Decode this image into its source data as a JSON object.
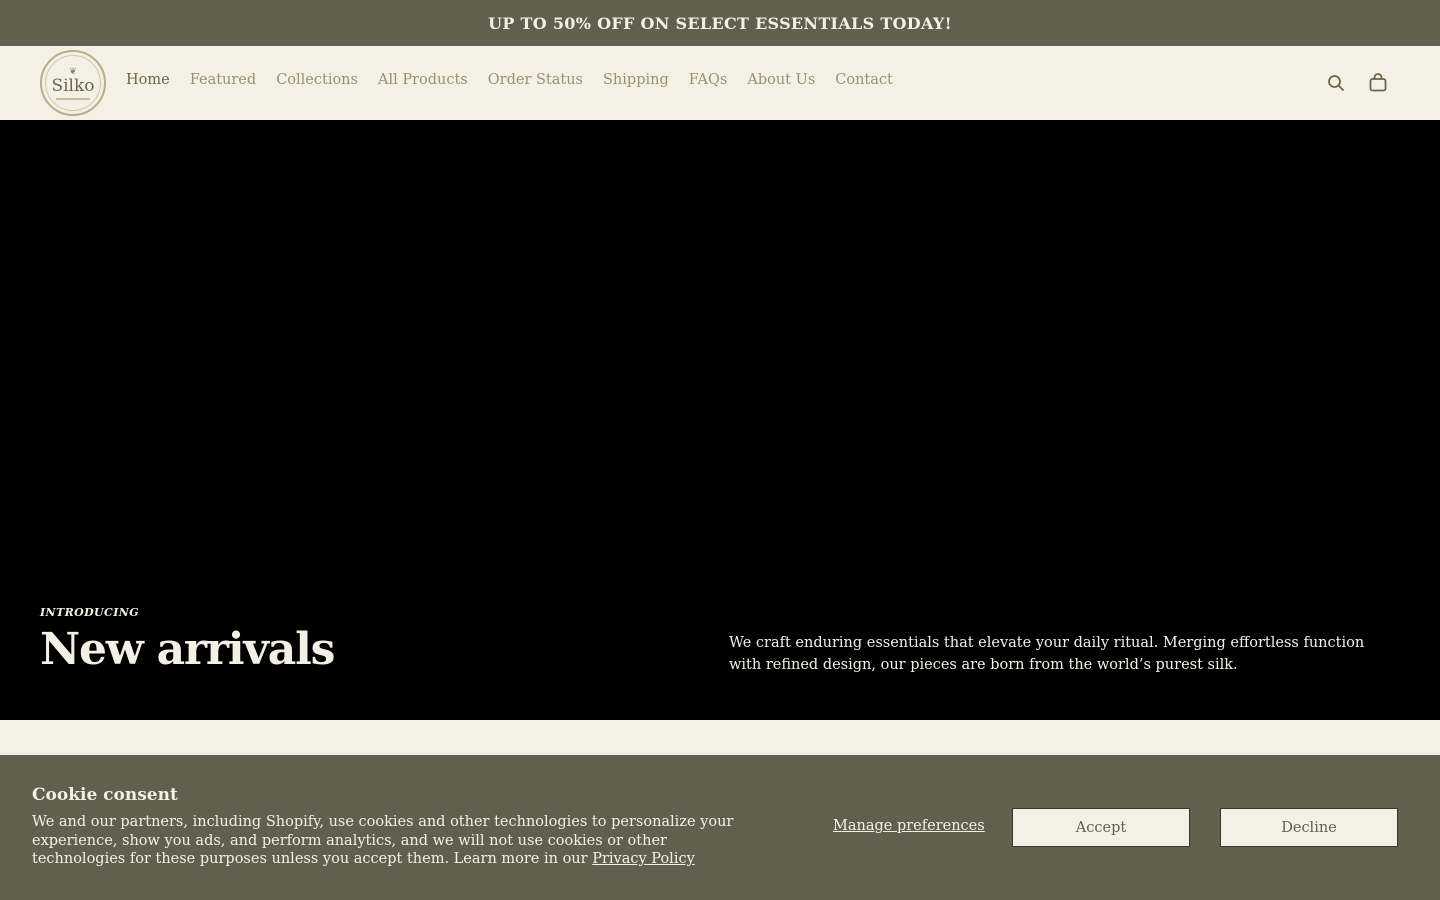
{
  "announcement": {
    "text": "UP TO 50% OFF ON SELECT ESSENTIALS TODAY!"
  },
  "header": {
    "logo_text": "Silko",
    "nav": [
      {
        "label": "Home",
        "active": true
      },
      {
        "label": "Featured",
        "active": false
      },
      {
        "label": "Collections",
        "active": false
      },
      {
        "label": "All Products",
        "active": false
      },
      {
        "label": "Order Status",
        "active": false
      },
      {
        "label": "Shipping",
        "active": false
      },
      {
        "label": "FAQs",
        "active": false
      },
      {
        "label": "About Us",
        "active": false
      },
      {
        "label": "Contact",
        "active": false
      }
    ],
    "icons": {
      "search": "search-icon",
      "cart": "cart-icon"
    }
  },
  "hero": {
    "eyebrow": "INTRODUCING",
    "title": "New arrivals",
    "description": "We craft enduring essentials that elevate your daily ritual. Merging effortless function with refined design, our pieces are born from the world’s purest silk."
  },
  "cookie": {
    "title": "Cookie consent",
    "text": "We and our partners, including Shopify, use cookies and other technologies to personalize your experience, show you ads, and perform analytics, and we will not use cookies or other technologies for these purposes unless you accept them. Learn more in our",
    "privacy_link": "Privacy Policy",
    "manage_label": "Manage preferences",
    "accept_label": "Accept",
    "decline_label": "Decline"
  },
  "colors": {
    "banner": "#645e4e",
    "cream": "#f4f0e5",
    "nav_text": "#9a9070",
    "nav_active": "#6d6547"
  }
}
